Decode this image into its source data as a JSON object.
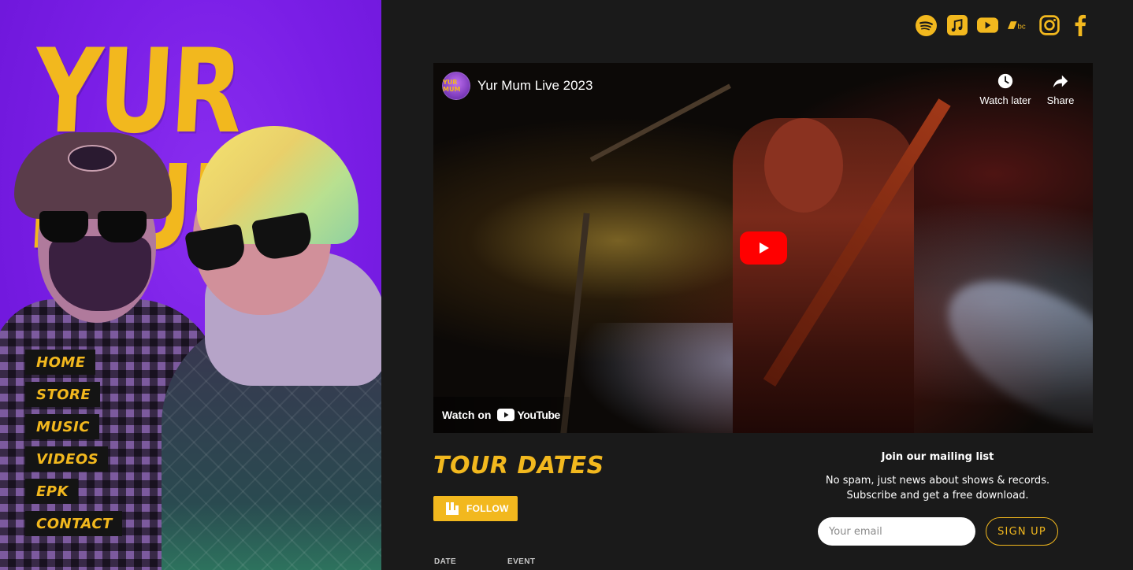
{
  "brand": {
    "logo_text": "YUR MUM",
    "accent": "#f2b81e",
    "panel_bg": "#7a1ee6",
    "page_bg": "#1a1a1a"
  },
  "nav": {
    "items": [
      {
        "label": "HOME"
      },
      {
        "label": "STORE"
      },
      {
        "label": "MUSIC"
      },
      {
        "label": "VIDEOS"
      },
      {
        "label": "EPK"
      },
      {
        "label": "CONTACT"
      }
    ]
  },
  "socials": [
    "spotify-icon",
    "apple-music-icon",
    "youtube-icon",
    "bandcamp-icon",
    "instagram-icon",
    "facebook-icon"
  ],
  "video": {
    "channel_avatar_text": "YUR MUM",
    "title": "Yur Mum Live 2023",
    "watch_later_label": "Watch later",
    "share_label": "Share",
    "watch_on_label": "Watch on",
    "youtube_wordmark": "YouTube"
  },
  "tour": {
    "title": "TOUR DATES",
    "follow_label": "FOLLOW",
    "columns": [
      "DATE",
      "EVENT"
    ]
  },
  "mailing": {
    "title": "Join our mailing list",
    "desc_line1": "No spam, just news about shows & records.",
    "desc_line2": "Subscribe and get a free download.",
    "email_placeholder": "Your email",
    "signup_label": "SIGN UP"
  }
}
